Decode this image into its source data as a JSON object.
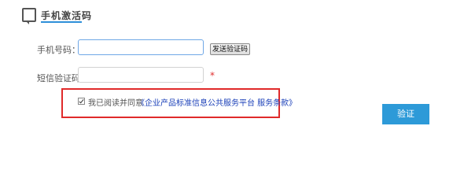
{
  "header": {
    "title": "手机激活码",
    "icon": "mobile-phone-icon"
  },
  "form": {
    "phone_label": "手机号码：",
    "phone_value": "",
    "send_button_label": "发送验证码",
    "code_label": "短信验证码：",
    "code_value": "",
    "required_mark": "*"
  },
  "agreement": {
    "checked": true,
    "text": "我已阅读并同意",
    "link_text": "《企业产品标准信息公共服务平台 服务条款》"
  },
  "actions": {
    "verify_label": "验证"
  },
  "colors": {
    "accent": "#2d9ad8",
    "highlight_border": "#e02a2a",
    "link": "#1a3fb8",
    "required": "#e03030"
  }
}
